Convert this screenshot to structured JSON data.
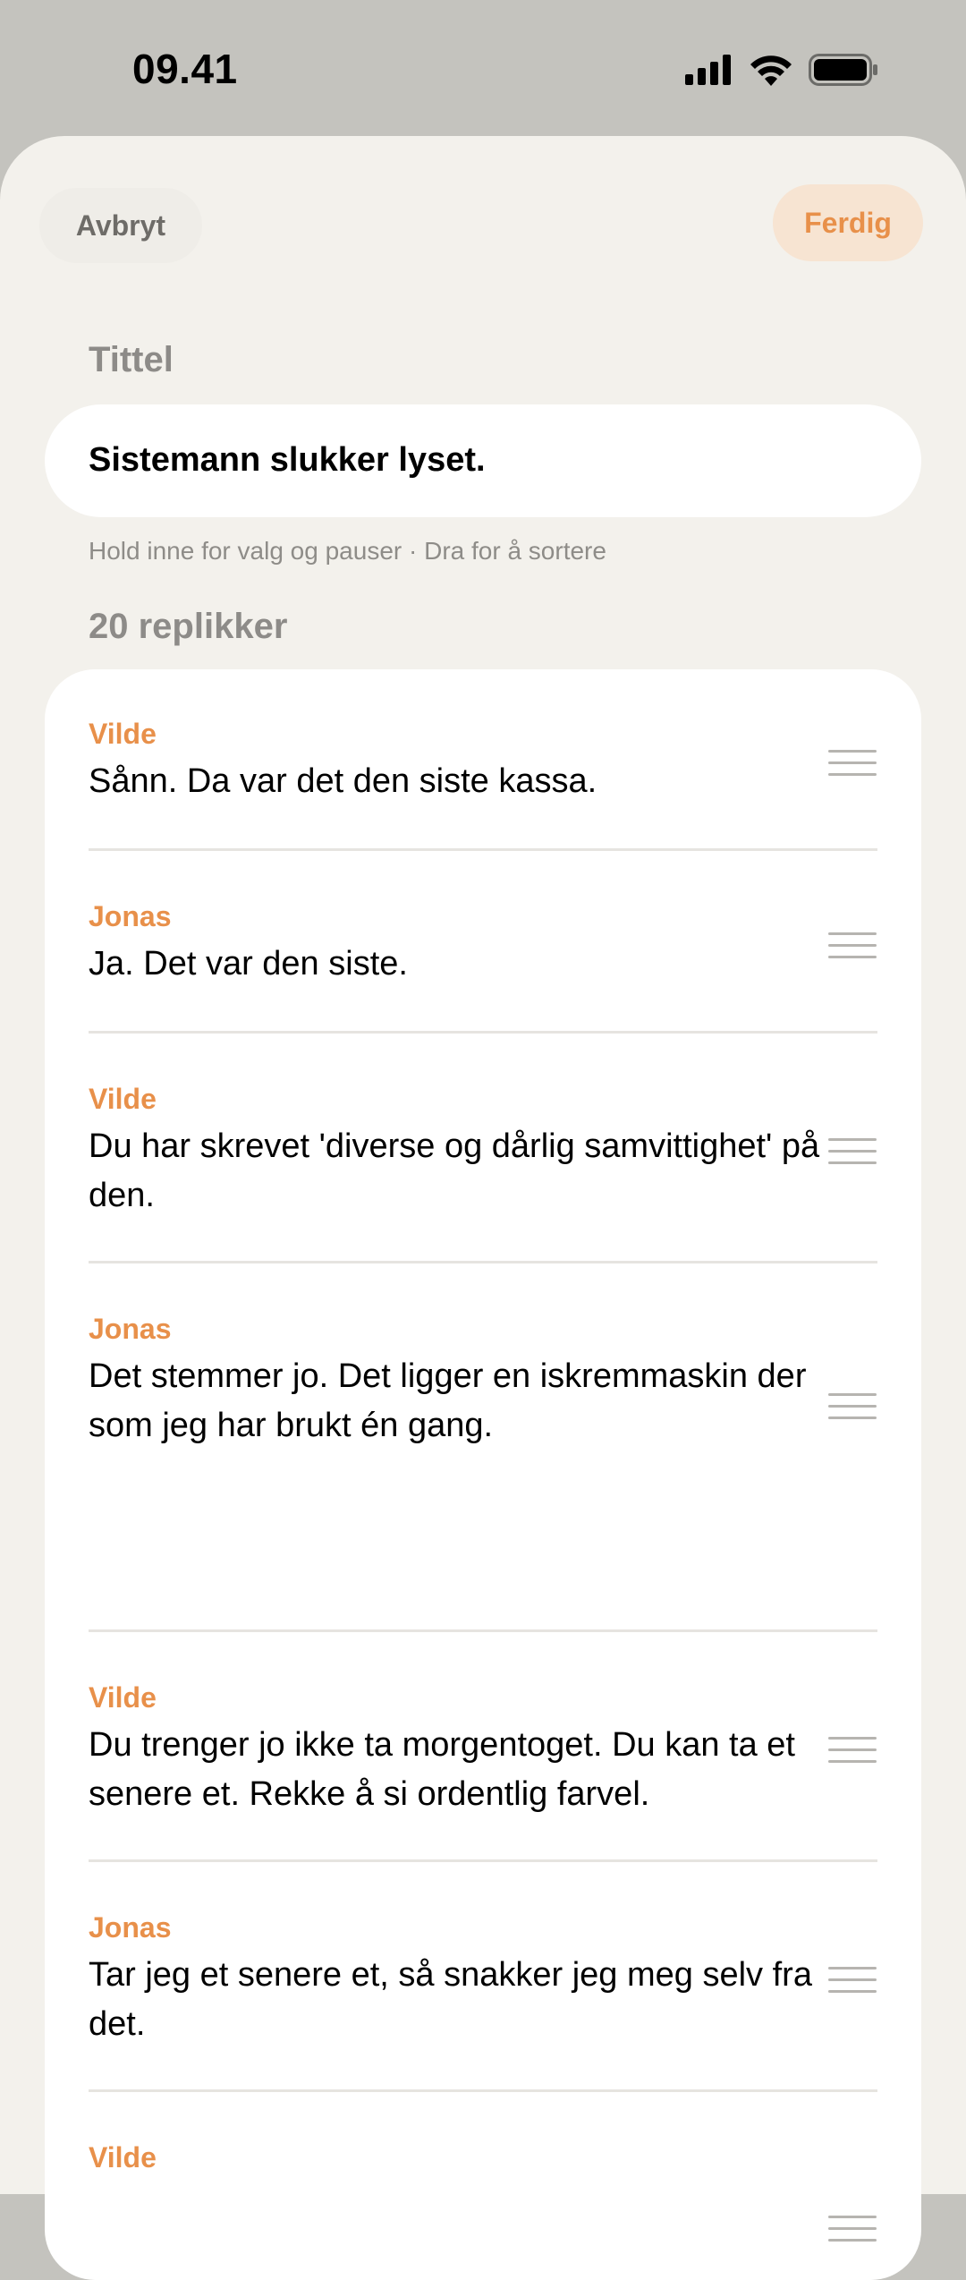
{
  "status_bar": {
    "time": "09.41"
  },
  "header": {
    "cancel_label": "Avbryt",
    "done_label": "Ferdig"
  },
  "title_section": {
    "label": "Tittel",
    "value": "Sistemann slukker lyset.",
    "hint": "Hold inne for valg og pauser · Dra for å sortere"
  },
  "lines_section": {
    "count_label": "20 replikker",
    "lines": [
      {
        "speaker": "Vilde",
        "text": "Sånn. Da var det den siste kassa."
      },
      {
        "speaker": "Jonas",
        "text": "Ja. Det var den siste."
      },
      {
        "speaker": "Vilde",
        "text": "Du har skrevet 'diverse og dårlig samvittighet' på den."
      },
      {
        "speaker": "Jonas",
        "text": "Det stemmer jo. Det ligger en iskremmaskin der som jeg har brukt én gang."
      },
      {
        "speaker": "Vilde",
        "text": "Du trenger jo ikke ta morgentoget. Du kan ta et senere et. Rekke å si ordentlig farvel."
      },
      {
        "speaker": "Jonas",
        "text": "Tar jeg et senere et, så snakker jeg meg selv fra det."
      },
      {
        "speaker": "Vilde",
        "text": ""
      }
    ]
  },
  "colors": {
    "accent": "#e8904a",
    "sheet_bg": "#f3f1ec",
    "backdrop": "#c4c3be"
  },
  "icons": [
    "cellular-signal-icon",
    "wifi-icon",
    "battery-icon",
    "drag-handle-icon"
  ]
}
